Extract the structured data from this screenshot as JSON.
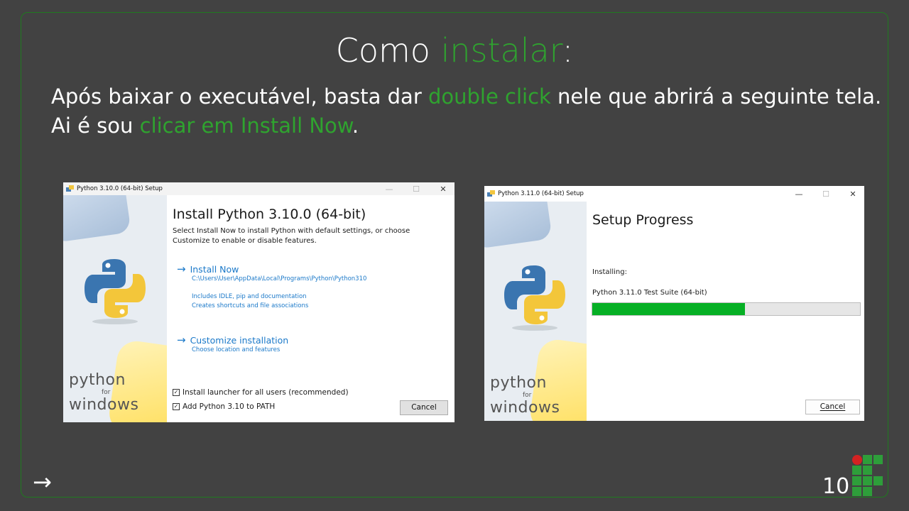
{
  "slide": {
    "title_prefix": "Como ",
    "title_highlight": "instalar",
    "title_suffix": ":",
    "desc_part1": "Após baixar o executável, basta dar ",
    "desc_highlight1": "double click",
    "desc_part2": " nele que abrirá a seguinte tela.",
    "desc_part3": "Ai é sou ",
    "desc_highlight2": "clicar em Install Now",
    "desc_part4": ".",
    "page_number": "10",
    "next_arrow": "→"
  },
  "colors": {
    "background": "#424242",
    "accent_green": "#2fa32f",
    "link_blue": "#1b79c9",
    "progress_green": "#06b025"
  },
  "window1": {
    "title": "Python 3.10.0 (64-bit) Setup",
    "heading": "Install Python 3.10.0 (64-bit)",
    "intro_line1": "Select Install Now to install Python with default settings, or choose",
    "intro_line2": "Customize to enable or disable features.",
    "install_now_label": "Install Now",
    "install_path": "C:\\Users\\User\\AppData\\Local\\Programs\\Python\\Python310",
    "install_note1": "Includes IDLE, pip and documentation",
    "install_note2": "Creates shortcuts and file associations",
    "customize_label": "Customize installation",
    "customize_note": "Choose location and features",
    "checkbox1_label": "Install launcher for all users (recommended)",
    "checkbox1_checked": true,
    "checkbox2_label": "Add Python 3.10 to PATH",
    "checkbox2_checked": true,
    "cancel_label": "Cancel",
    "side_big1": "python",
    "side_small": "for",
    "side_big2": "windows"
  },
  "window2": {
    "title": "Python 3.11.0 (64-bit) Setup",
    "heading": "Setup Progress",
    "status_label": "Installing:",
    "current_item": "Python 3.11.0 Test Suite (64-bit)",
    "progress": 0.57,
    "cancel_label": "Cancel",
    "side_big1": "python",
    "side_small": "for",
    "side_big2": "windows"
  },
  "icons": {
    "next": "arrow-right-icon",
    "window_app": "python-setup-icon",
    "minimize": "minimize-icon",
    "maximize": "maximize-icon",
    "close": "close-icon",
    "link_arrow": "arrow-right-icon",
    "checkbox": "checkbox-checked-icon",
    "institution": "ifsp-logo-icon"
  }
}
